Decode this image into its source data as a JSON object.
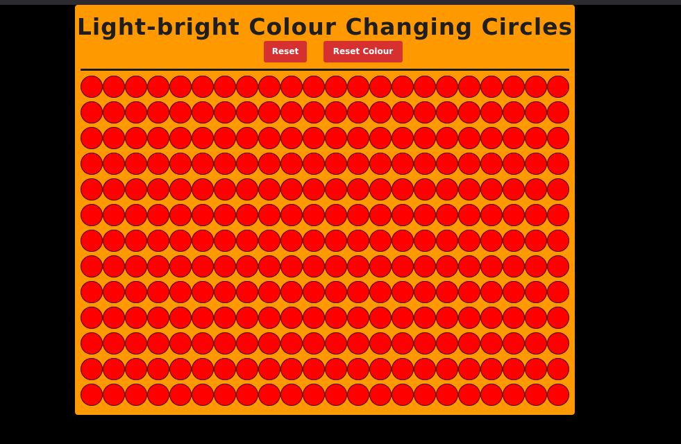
{
  "page": {
    "title": "Light-bright Colour Changing Circles"
  },
  "controls": {
    "reset_label": "Reset",
    "reset_colour_label": "Reset Colour"
  },
  "colors": {
    "page_background": "#000000",
    "panel_background": "#ff9900",
    "button_background": "#d63030",
    "circle_fill": "#ff0000",
    "divider": "#1a1a1a"
  },
  "grid": {
    "rows": 13,
    "columns": 22,
    "circle_color": "#ff0000"
  }
}
